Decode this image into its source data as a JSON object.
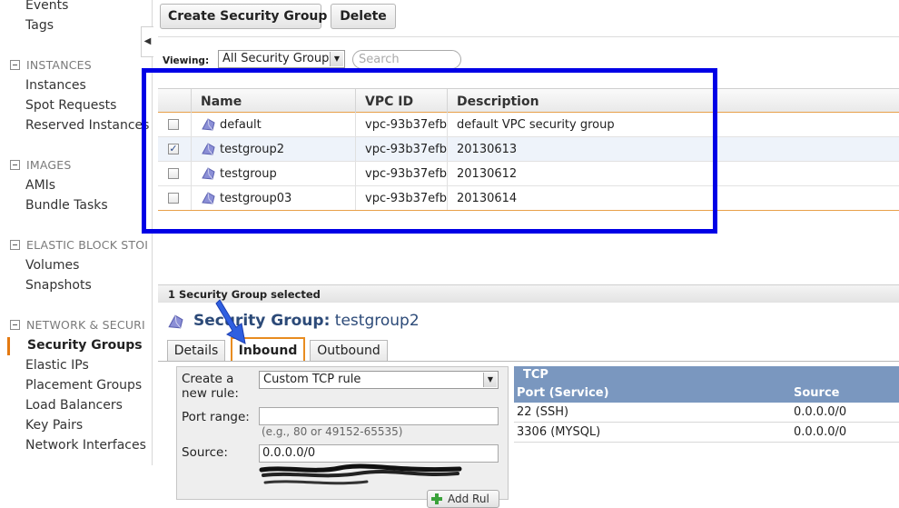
{
  "sidebar": {
    "items_top": [
      "Events",
      "Tags"
    ],
    "sections": [
      {
        "header": "INSTANCES",
        "items": [
          "Instances",
          "Spot Requests",
          "Reserved Instances"
        ]
      },
      {
        "header": "IMAGES",
        "items": [
          "AMIs",
          "Bundle Tasks"
        ]
      },
      {
        "header": "ELASTIC BLOCK STOI",
        "items": [
          "Volumes",
          "Snapshots"
        ]
      },
      {
        "header": "NETWORK & SECURI",
        "items": [
          "Security Groups",
          "Elastic IPs",
          "Placement Groups",
          "Load Balancers",
          "Key Pairs",
          "Network Interfaces"
        ]
      }
    ],
    "active_item": "Security Groups",
    "collapse_glyph": "◀"
  },
  "toolbar": {
    "create_label": "Create Security Group",
    "delete_label": "Delete",
    "viewing_label": "Viewing:",
    "viewing_value": "All Security Groups",
    "search_placeholder": "Search"
  },
  "table": {
    "columns": [
      "Name",
      "VPC ID",
      "Description"
    ],
    "rows": [
      {
        "checked": false,
        "name": "default",
        "vpc": "vpc-93b37efb",
        "description": "default VPC security group"
      },
      {
        "checked": true,
        "name": "testgroup2",
        "vpc": "vpc-93b37efb",
        "description": "20130613"
      },
      {
        "checked": false,
        "name": "testgroup",
        "vpc": "vpc-93b37efb",
        "description": "20130612"
      },
      {
        "checked": false,
        "name": "testgroup03",
        "vpc": "vpc-93b37efb",
        "description": "20130614"
      }
    ],
    "check_glyph": "✓"
  },
  "detail": {
    "selection_count": "1 Security Group selected",
    "title_prefix": "Security Group:",
    "title_name": "testgroup2",
    "tabs": [
      "Details",
      "Inbound",
      "Outbound"
    ],
    "active_tab": "Inbound"
  },
  "rule_form": {
    "create_label_line1": "Create a",
    "create_label_line2": "new rule:",
    "rule_type": "Custom TCP rule",
    "port_range_label": "Port range:",
    "port_range_value": "",
    "port_range_hint": "(e.g., 80 or 49152-65535)",
    "source_label": "Source:",
    "source_value": "0.0.0.0/0",
    "add_button_label": "Add Rul"
  },
  "inbound_rules": {
    "protocol": "TCP",
    "col_port": "Port (Service)",
    "col_source": "Source",
    "rows": [
      {
        "port": "22 (SSH)",
        "source": "0.0.0.0/0"
      },
      {
        "port": "3306 (MYSQL)",
        "source": "0.0.0.0/0"
      }
    ]
  },
  "colors": {
    "highlight_box": "#0000e6",
    "annotation_arrow": "#2f5fe0",
    "active_accent": "#e47911",
    "rules_header": "#7a97bf"
  }
}
